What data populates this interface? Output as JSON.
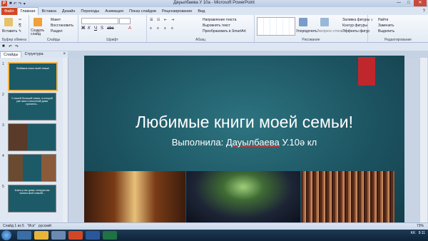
{
  "window": {
    "title": "Дауылбаева У 10a  -  Microsoft PowerPoint"
  },
  "tabs": [
    "Файл",
    "Главная",
    "Вставка",
    "Дизайн",
    "Переходы",
    "Анимация",
    "Показ слайдов",
    "Рецензирование",
    "Вид"
  ],
  "ribbon": {
    "clipboard": {
      "label": "Буфер обмена",
      "paste": "Вставить"
    },
    "slides": {
      "label": "Слайды",
      "new_slide": "Создать слайд",
      "layout": "Макет",
      "reset": "Восстановить",
      "section": "Раздел"
    },
    "font": {
      "label": "Шрифт"
    },
    "paragraph": {
      "label": "Абзац",
      "text_direction": "Направление текста",
      "align_text": "Выровнять текст",
      "smartart": "Преобразовать в SmartArt"
    },
    "drawing": {
      "label": "Рисование",
      "arrange": "Упорядочить",
      "quick_styles": "Экспресс-стили",
      "fill": "Заливка фигуры",
      "outline": "Контур фигуры",
      "effects": "Эффекты фигур"
    },
    "editing": {
      "label": "Редактирование",
      "find": "Найти",
      "replace": "Заменить",
      "select": "Выделить"
    }
  },
  "panel_tabs": {
    "slides": "Слайды",
    "outline": "Структура"
  },
  "thumbnails": [
    {
      "num": "1",
      "text": "Любимые книги моей семьи!"
    },
    {
      "num": "2",
      "text": "У нашей большой семьи, в которой уже много поколений дома хранится..."
    },
    {
      "num": "3",
      "text": ""
    },
    {
      "num": "4",
      "text": ""
    },
    {
      "num": "5",
      "text": "Книга у нас дома, которую мы читаем всей семьёй..."
    }
  ],
  "slide": {
    "title": "Любимые книги моей семьи!",
    "sub_prefix": "Выполнила: ",
    "sub_name": "Дауылбаева",
    "sub_suffix": " У.10ә кл"
  },
  "status": {
    "slide_info": "Слайд 1 из 5",
    "theme": "\"Иск\"",
    "language": "русский",
    "zoom": "73%"
  },
  "taskbar": {
    "lang": "KK",
    "time": "9:11"
  },
  "colors": {
    "accent": "#d24726",
    "slide_bg": "#1c5260",
    "red_bar": "#c0272d"
  }
}
